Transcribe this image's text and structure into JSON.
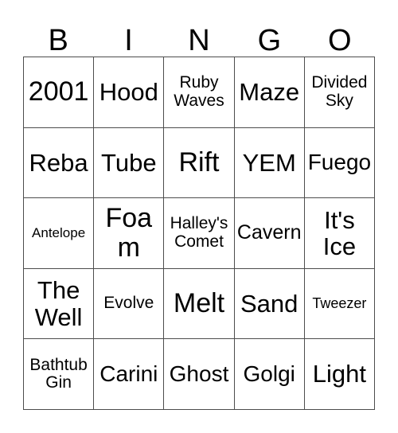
{
  "card": {
    "title": "BINGO",
    "headers": [
      "B",
      "I",
      "N",
      "G",
      "O"
    ],
    "rows": [
      [
        {
          "text": "2001",
          "size": "sz-xl"
        },
        {
          "text": "Hood",
          "size": "sz-lg"
        },
        {
          "text": "Ruby Waves",
          "size": "sz-xs"
        },
        {
          "text": "Maze",
          "size": "sz-lg"
        },
        {
          "text": "Divided Sky",
          "size": "sz-xs"
        }
      ],
      [
        {
          "text": "Reba",
          "size": "sz-lg"
        },
        {
          "text": "Tube",
          "size": "sz-lg"
        },
        {
          "text": "Rift",
          "size": "sz-xl"
        },
        {
          "text": "YEM",
          "size": "sz-lg"
        },
        {
          "text": "Fuego",
          "size": "sz-md"
        }
      ],
      [
        {
          "text": "Antelope",
          "size": "sz-min"
        },
        {
          "text": "Foam",
          "size": "sz-xl"
        },
        {
          "text": "Halley's Comet",
          "size": "sz-xs"
        },
        {
          "text": "Cavern",
          "size": "sz-sm"
        },
        {
          "text": "It's Ice",
          "size": "sz-lg"
        }
      ],
      [
        {
          "text": "The Well",
          "size": "sz-lg"
        },
        {
          "text": "Evolve",
          "size": "sz-xs"
        },
        {
          "text": "Melt",
          "size": "sz-xl"
        },
        {
          "text": "Sand",
          "size": "sz-lg"
        },
        {
          "text": "Tweezer",
          "size": "sz-xxs"
        }
      ],
      [
        {
          "text": "Bathtub Gin",
          "size": "sz-xs"
        },
        {
          "text": "Carini",
          "size": "sz-md"
        },
        {
          "text": "Ghost",
          "size": "sz-md"
        },
        {
          "text": "Golgi",
          "size": "sz-md"
        },
        {
          "text": "Light",
          "size": "sz-lg"
        }
      ]
    ],
    "colors": {
      "border": "#4d4d4d",
      "text": "#000000",
      "background": "#ffffff"
    }
  }
}
